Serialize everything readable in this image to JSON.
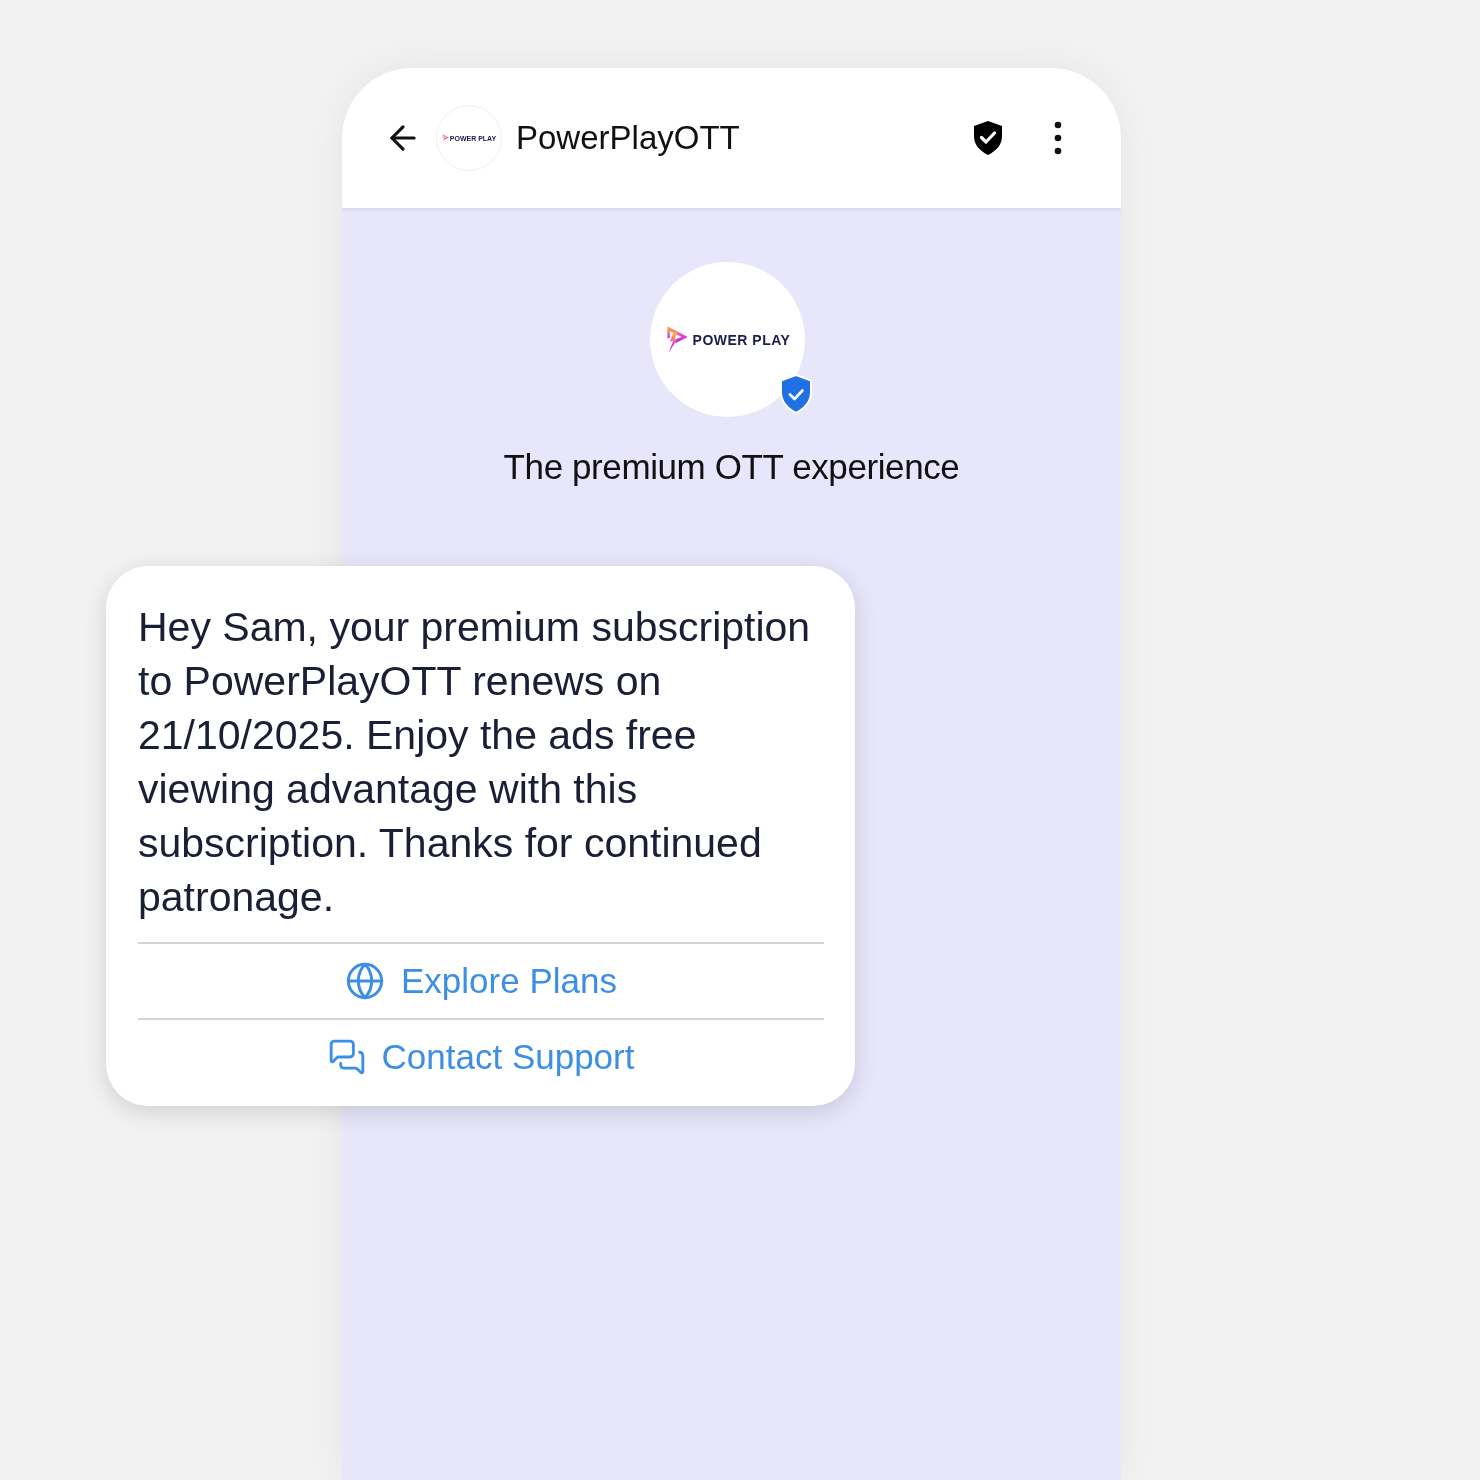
{
  "header": {
    "logo_text": "POWER PLAY",
    "title": "PowerPlayOTT",
    "verified": true
  },
  "profile": {
    "logo_text": "POWER PLAY",
    "verified": true,
    "tagline": "The premium OTT experience"
  },
  "message": {
    "text": "Hey Sam, your premium subscription to PowerPlayOTT renews on 21/10/2025. Enjoy the ads free viewing advantage with this subscription. Thanks for continued patronage.",
    "actions": [
      {
        "kind": "web",
        "label": "Explore Plans"
      },
      {
        "kind": "chat",
        "label": "Contact Support"
      }
    ]
  }
}
